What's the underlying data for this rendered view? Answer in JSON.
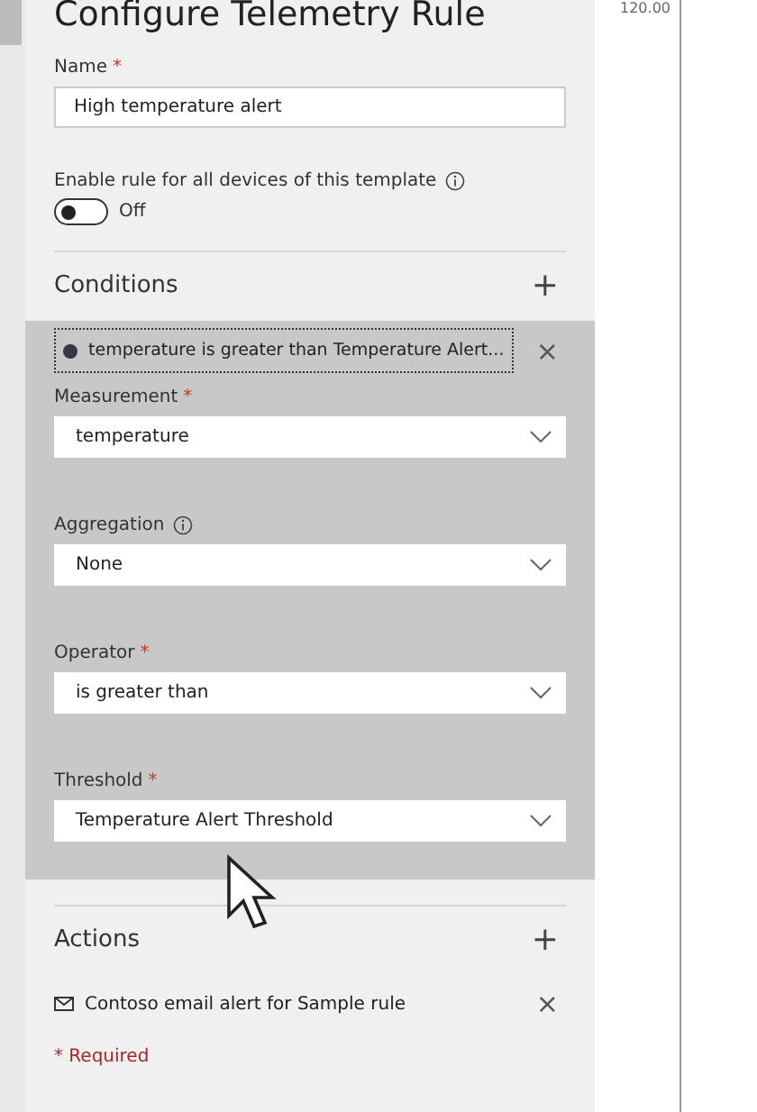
{
  "panel": {
    "title": "Configure Telemetry Rule"
  },
  "name_field": {
    "label": "Name",
    "marker": "*",
    "value": "High temperature alert"
  },
  "enable_toggle": {
    "label": "Enable rule for all devices of this template",
    "on": false,
    "state_label": "Off"
  },
  "conditions": {
    "heading": "Conditions",
    "add": "+",
    "item": {
      "summary": "temperature is greater than Temperature Alert...",
      "remove": "×"
    },
    "fields": [
      {
        "label": "Measurement",
        "marker": "*",
        "info": false,
        "value": "temperature"
      },
      {
        "label": "Aggregation",
        "info": true,
        "value": "None"
      },
      {
        "label": "Operator",
        "marker": "*",
        "info": false,
        "value": "is greater than"
      },
      {
        "label": "Threshold",
        "marker": "*",
        "info": false,
        "value": "Temperature Alert Threshold"
      }
    ]
  },
  "actions": {
    "heading": "Actions",
    "add": "+",
    "items": [
      {
        "label": "Contoso email alert for Sample rule",
        "remove": "×"
      }
    ]
  },
  "required_note": "* Required",
  "chart": {
    "axis_label": "120.00"
  }
}
